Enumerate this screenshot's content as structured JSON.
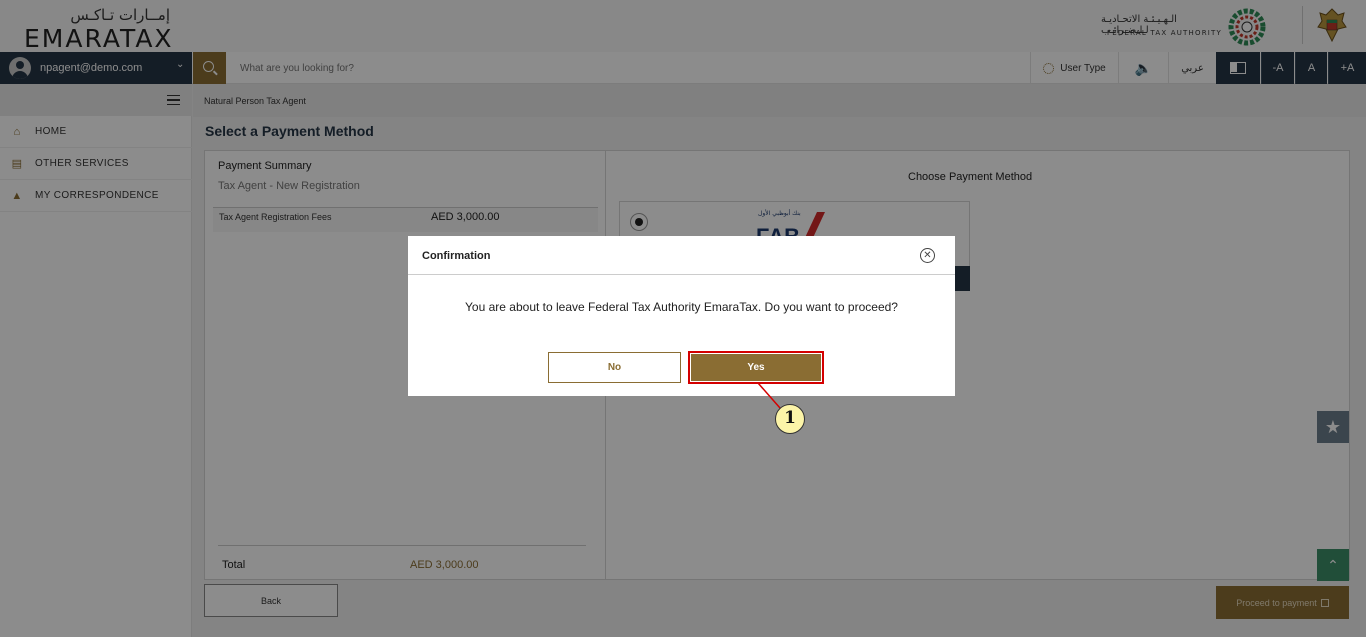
{
  "header": {
    "logo_ar": "إمــارات تـاكـس",
    "logo_en": "EMARATAX",
    "fta_ar": "الـهـيـئـة الاتحـاديـة لـلـضـرائـب",
    "fta_en": "FEDERAL TAX AUTHORITY"
  },
  "toolbar": {
    "user_email": "npagent@demo.com",
    "search_placeholder": "What are you looking for?",
    "user_type": "User Type",
    "arabic": "عربي",
    "font_decrease": "-A",
    "font_normal": "A",
    "font_increase": "+A"
  },
  "sidebar": {
    "items": [
      {
        "label": "HOME"
      },
      {
        "label": "OTHER SERVICES"
      },
      {
        "label": "MY CORRESPONDENCE"
      }
    ]
  },
  "breadcrumb": "Natural Person Tax Agent",
  "page_title": "Select a Payment Method",
  "summary": {
    "title": "Payment Summary",
    "subtitle": "Tax Agent - New Registration",
    "fee_label": "Tax Agent Registration Fees",
    "fee_amount": "AED 3,000.00",
    "total_label": "Total",
    "total_amount": "AED  3,000.00"
  },
  "payment": {
    "choose_title": "Choose Payment Method",
    "bank_ar": "بنك أبوظبي الأول",
    "bank_en": "FAB"
  },
  "footer": {
    "back_label": "Back",
    "proceed_label": "Proceed to payment"
  },
  "modal": {
    "title": "Confirmation",
    "message": "You are about to leave Federal Tax Authority EmaraTax. Do you want to proceed?",
    "no_label": "No",
    "yes_label": "Yes"
  },
  "callout": {
    "number": "1"
  }
}
